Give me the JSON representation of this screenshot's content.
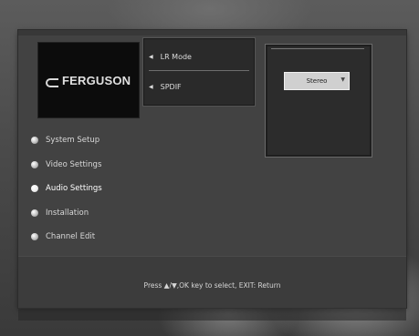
{
  "brand": {
    "logo_text": "FERGUSON"
  },
  "main_menu": {
    "items": [
      {
        "label": "System Setup",
        "active": false
      },
      {
        "label": "Video Settings",
        "active": false
      },
      {
        "label": "Audio Settings",
        "active": true
      },
      {
        "label": "Installation",
        "active": false
      },
      {
        "label": "Channel Edit",
        "active": false
      }
    ]
  },
  "submenu": {
    "items": [
      {
        "label": "LR Mode"
      },
      {
        "label": "SPDIF"
      }
    ]
  },
  "option_panel": {
    "selected_value": "Stereo"
  },
  "footer": {
    "hint": "Press ▲/▼,OK key to select, EXIT: Return"
  }
}
